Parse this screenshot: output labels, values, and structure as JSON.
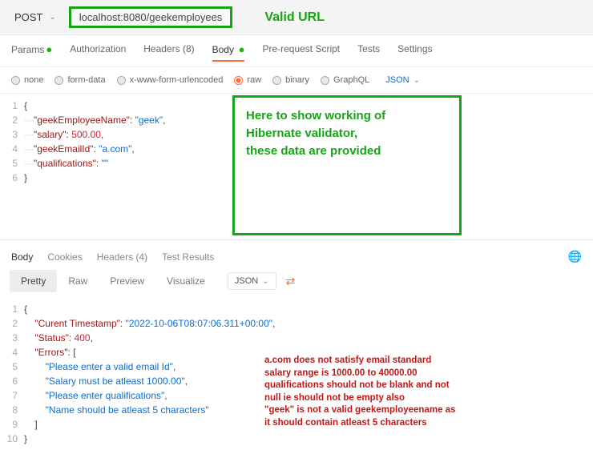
{
  "method": "POST",
  "url": "localhost:8080/geekemployees",
  "valid_url_label": "Valid URL",
  "req_tabs": {
    "params": "Params",
    "auth": "Authorization",
    "headers": "Headers (8)",
    "body": "Body",
    "prereq": "Pre-request Script",
    "tests": "Tests",
    "settings": "Settings"
  },
  "body_types": {
    "none": "none",
    "formdata": "form-data",
    "xwww": "x-www-form-urlencoded",
    "raw": "raw",
    "binary": "binary",
    "graphql": "GraphQL",
    "json": "JSON"
  },
  "request_body": {
    "l1": "{",
    "l2_key": "\"geekEmployeeName\"",
    "l2_val": "\"geek\"",
    "l3_key": "\"salary\"",
    "l3_val": "500.00",
    "l4_key": "\"geekEmailId\"",
    "l4_val": "\"a.com\"",
    "l5_key": "\"qualifications\"",
    "l5_val": "\"\"",
    "l6": "}"
  },
  "annotation1": {
    "l1": "Here to show working of",
    "l2": "Hibernate validator,",
    "l3": "these data are provided"
  },
  "resp_tabs": {
    "body": "Body",
    "cookies": "Cookies",
    "headers": "Headers (4)",
    "tests": "Test Results"
  },
  "resp_views": {
    "pretty": "Pretty",
    "raw": "Raw",
    "preview": "Preview",
    "visualize": "Visualize",
    "json": "JSON"
  },
  "response_body": {
    "l2_key": "\"Curent Timestamp\"",
    "l2_val": "\"2022-10-06T08:07:06.311+00:00\"",
    "l3_key": "\"Status\"",
    "l3_val": "400",
    "l4_key": "\"Errors\"",
    "l5": "\"Please enter a valid email Id\"",
    "l6": "\"Salary must be atleast 1000.00\"",
    "l7": "\"Please enter qualifications\"",
    "l8": "\"Name should be atleast 5 characters\""
  },
  "annotation2": {
    "l1": "a.com does not satisfy email standard",
    "l2": "salary range is 1000.00 to 40000.00",
    "l3": "qualifications should not be blank and not",
    "l4": "null ie should not be empty also",
    "l5": "\"geek\" is not a valid geekemployeename as",
    "l6": "it should contain atleast 5 characters"
  }
}
